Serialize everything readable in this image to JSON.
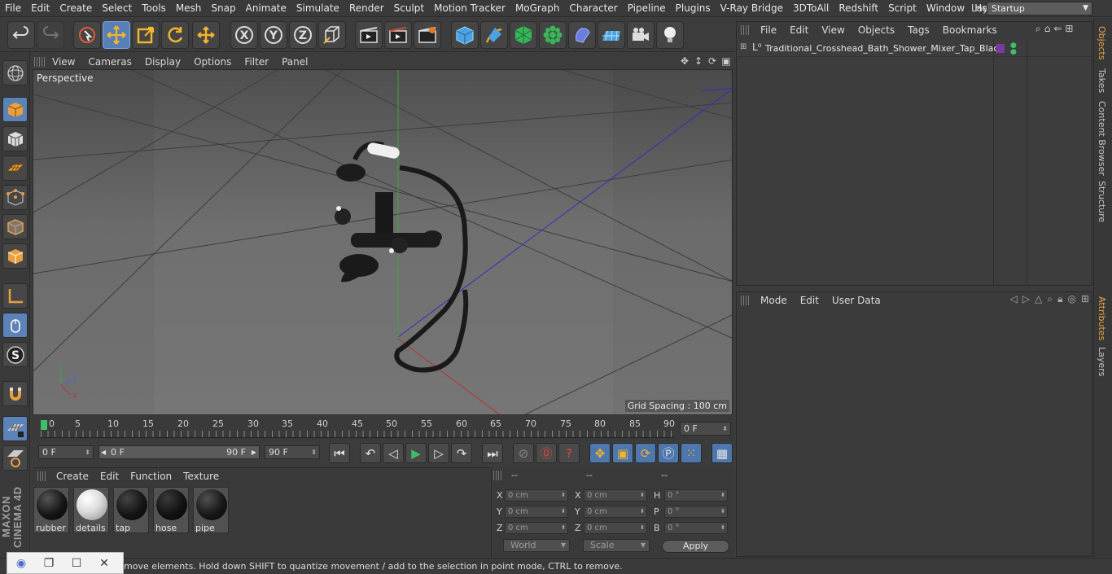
{
  "menubar": {
    "items": [
      "File",
      "Edit",
      "Create",
      "Select",
      "Tools",
      "Mesh",
      "Snap",
      "Animate",
      "Simulate",
      "Render",
      "Sculpt",
      "Motion Tracker",
      "MoGraph",
      "Character",
      "Pipeline",
      "Plugins",
      "V-Ray Bridge",
      "3DToAll",
      "Redshift",
      "Script",
      "Window",
      "Help"
    ],
    "layout_label": "Layout:",
    "layout_value": "Startup"
  },
  "viewport": {
    "menu": [
      "View",
      "Cameras",
      "Display",
      "Options",
      "Filter",
      "Panel"
    ],
    "label": "Perspective",
    "grid_spacing": "Grid Spacing : 100 cm",
    "axis_y": "Y",
    "axis_z": "Z",
    "axis_x": "X"
  },
  "timeline": {
    "ticks": [
      "0",
      "5",
      "10",
      "15",
      "20",
      "25",
      "30",
      "35",
      "40",
      "45",
      "50",
      "55",
      "60",
      "65",
      "70",
      "75",
      "80",
      "85",
      "90"
    ],
    "current_frame_end": "0 F",
    "start_field": "0 F",
    "range_start": "0 F",
    "range_end": "90 F",
    "end_field": "90 F"
  },
  "materials": {
    "menu": [
      "Create",
      "Edit",
      "Function",
      "Texture"
    ],
    "items": [
      {
        "name": "rubber",
        "color": "#161616"
      },
      {
        "name": "details",
        "color": "#e8e8e8"
      },
      {
        "name": "tap",
        "color": "#1a1a1a"
      },
      {
        "name": "hose",
        "color": "#141414"
      },
      {
        "name": "pipe",
        "color": "#1c1c1c"
      }
    ]
  },
  "coords": {
    "headers": [
      "--",
      "--",
      "--"
    ],
    "rows": [
      {
        "l1": "X",
        "v1": "0 cm",
        "l2": "X",
        "v2": "0 cm",
        "l3": "H",
        "v3": "0 °"
      },
      {
        "l1": "Y",
        "v1": "0 cm",
        "l2": "Y",
        "v2": "0 cm",
        "l3": "P",
        "v3": "0 °"
      },
      {
        "l1": "Z",
        "v1": "0 cm",
        "l2": "Z",
        "v2": "0 cm",
        "l3": "B",
        "v3": "0 °"
      }
    ],
    "world": "World",
    "scale": "Scale",
    "apply": "Apply"
  },
  "status": "move elements. Hold down SHIFT to quantize movement / add to the selection in point mode, CTRL to remove.",
  "objects": {
    "menu": [
      "File",
      "Edit",
      "View",
      "Objects",
      "Tags",
      "Bookmarks"
    ],
    "item": "Traditional_Crosshead_Bath_Shower_Mixer_Tap_Black"
  },
  "attributes": {
    "menu": [
      "Mode",
      "Edit",
      "User Data"
    ]
  },
  "sidetabs": {
    "objects": "Objects",
    "takes": "Takes",
    "content": "Content Browser",
    "structure": "Structure",
    "attributes": "Attributes",
    "layers": "Layers"
  },
  "branding": {
    "logo": "MAXON CINEMA 4D"
  },
  "colors": {
    "accent": "#5880b8",
    "active_tab": "#e8a64a",
    "frame_marker": "#3fbf6a"
  }
}
